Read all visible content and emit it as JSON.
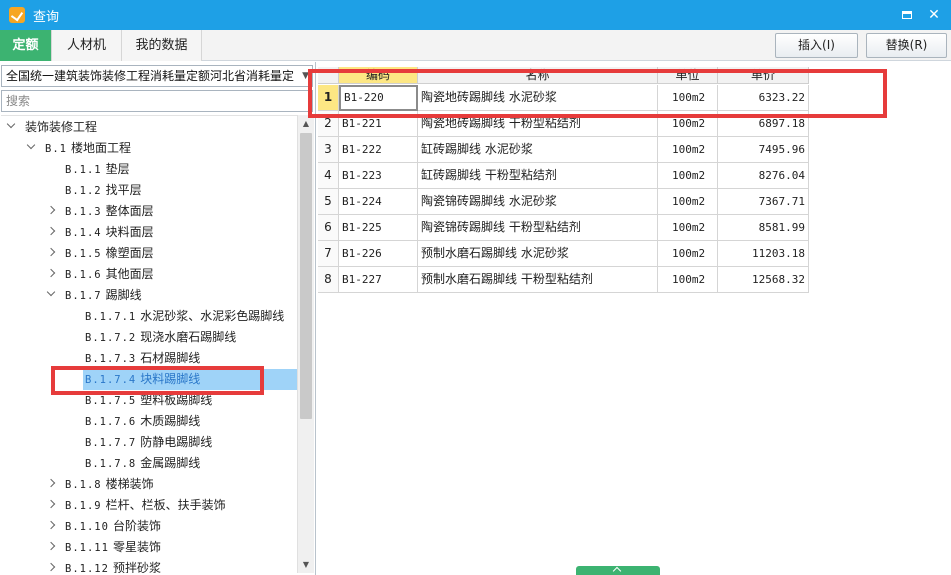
{
  "window": {
    "title": "查询"
  },
  "tabs": [
    {
      "label": "定额",
      "active": true
    },
    {
      "label": "人材机",
      "active": false
    },
    {
      "label": "我的数据",
      "active": false
    }
  ],
  "toolbar": {
    "insert_label": "插入(I)",
    "replace_label": "替换(R)"
  },
  "library": {
    "selected": "全国统一建筑装饰装修工程消耗量定额河北省消耗量定"
  },
  "search": {
    "placeholder": "搜索"
  },
  "tree": [
    {
      "code": "",
      "label": "装饰装修工程",
      "level": 0,
      "state": "expanded"
    },
    {
      "code": "B.1",
      "label": "楼地面工程",
      "level": 1,
      "state": "expanded"
    },
    {
      "code": "B.1.1",
      "label": "垫层",
      "level": 2,
      "state": "leaf"
    },
    {
      "code": "B.1.2",
      "label": "找平层",
      "level": 2,
      "state": "leaf"
    },
    {
      "code": "B.1.3",
      "label": "整体面层",
      "level": 2,
      "state": "collapsed"
    },
    {
      "code": "B.1.4",
      "label": "块料面层",
      "level": 2,
      "state": "collapsed"
    },
    {
      "code": "B.1.5",
      "label": "橡塑面层",
      "level": 2,
      "state": "collapsed"
    },
    {
      "code": "B.1.6",
      "label": "其他面层",
      "level": 2,
      "state": "collapsed"
    },
    {
      "code": "B.1.7",
      "label": "踢脚线",
      "level": 2,
      "state": "expanded"
    },
    {
      "code": "B.1.7.1",
      "label": "水泥砂浆、水泥彩色踢脚线",
      "level": 3,
      "state": "leaf"
    },
    {
      "code": "B.1.7.2",
      "label": "现浇水磨石踢脚线",
      "level": 3,
      "state": "leaf"
    },
    {
      "code": "B.1.7.3",
      "label": "石材踢脚线",
      "level": 3,
      "state": "leaf"
    },
    {
      "code": "B.1.7.4",
      "label": "块料踢脚线",
      "level": 3,
      "state": "leaf",
      "selected": true
    },
    {
      "code": "B.1.7.5",
      "label": "塑料板踢脚线",
      "level": 3,
      "state": "leaf"
    },
    {
      "code": "B.1.7.6",
      "label": "木质踢脚线",
      "level": 3,
      "state": "leaf"
    },
    {
      "code": "B.1.7.7",
      "label": "防静电踢脚线",
      "level": 3,
      "state": "leaf"
    },
    {
      "code": "B.1.7.8",
      "label": "金属踢脚线",
      "level": 3,
      "state": "leaf"
    },
    {
      "code": "B.1.8",
      "label": "楼梯装饰",
      "level": 2,
      "state": "collapsed"
    },
    {
      "code": "B.1.9",
      "label": "栏杆、栏板、扶手装饰",
      "level": 2,
      "state": "collapsed"
    },
    {
      "code": "B.1.10",
      "label": "台阶装饰",
      "level": 2,
      "state": "collapsed"
    },
    {
      "code": "B.1.11",
      "label": "零星装饰",
      "level": 2,
      "state": "collapsed"
    },
    {
      "code": "B.1.12",
      "label": "预拌砂浆",
      "level": 2,
      "state": "collapsed"
    }
  ],
  "table": {
    "columns": [
      "编码",
      "名称",
      "单位",
      "单价"
    ],
    "rows": [
      {
        "no": "1",
        "code": "B1-220",
        "name": "陶瓷地砖踢脚线 水泥砂浆",
        "unit": "100m2",
        "price": "6323.22",
        "current": true
      },
      {
        "no": "2",
        "code": "B1-221",
        "name": "陶瓷地砖踢脚线 干粉型粘结剂",
        "unit": "100m2",
        "price": "6897.18"
      },
      {
        "no": "3",
        "code": "B1-222",
        "name": "缸砖踢脚线 水泥砂浆",
        "unit": "100m2",
        "price": "7495.96"
      },
      {
        "no": "4",
        "code": "B1-223",
        "name": "缸砖踢脚线 干粉型粘结剂",
        "unit": "100m2",
        "price": "8276.04"
      },
      {
        "no": "5",
        "code": "B1-224",
        "name": "陶瓷锦砖踢脚线 水泥砂浆",
        "unit": "100m2",
        "price": "7367.71"
      },
      {
        "no": "6",
        "code": "B1-225",
        "name": "陶瓷锦砖踢脚线 干粉型粘结剂",
        "unit": "100m2",
        "price": "8581.99"
      },
      {
        "no": "7",
        "code": "B1-226",
        "name": "预制水磨石踢脚线 水泥砂浆",
        "unit": "100m2",
        "price": "11203.18"
      },
      {
        "no": "8",
        "code": "B1-227",
        "name": "预制水磨石踢脚线 干粉型粘结剂",
        "unit": "100m2",
        "price": "12568.32"
      }
    ]
  },
  "colors": {
    "titlebar": "#1ea0e6",
    "active_tab": "#3cb371",
    "highlight": "#e63b3b",
    "selection": "#9fd3f8",
    "current_row": "#fde784"
  }
}
